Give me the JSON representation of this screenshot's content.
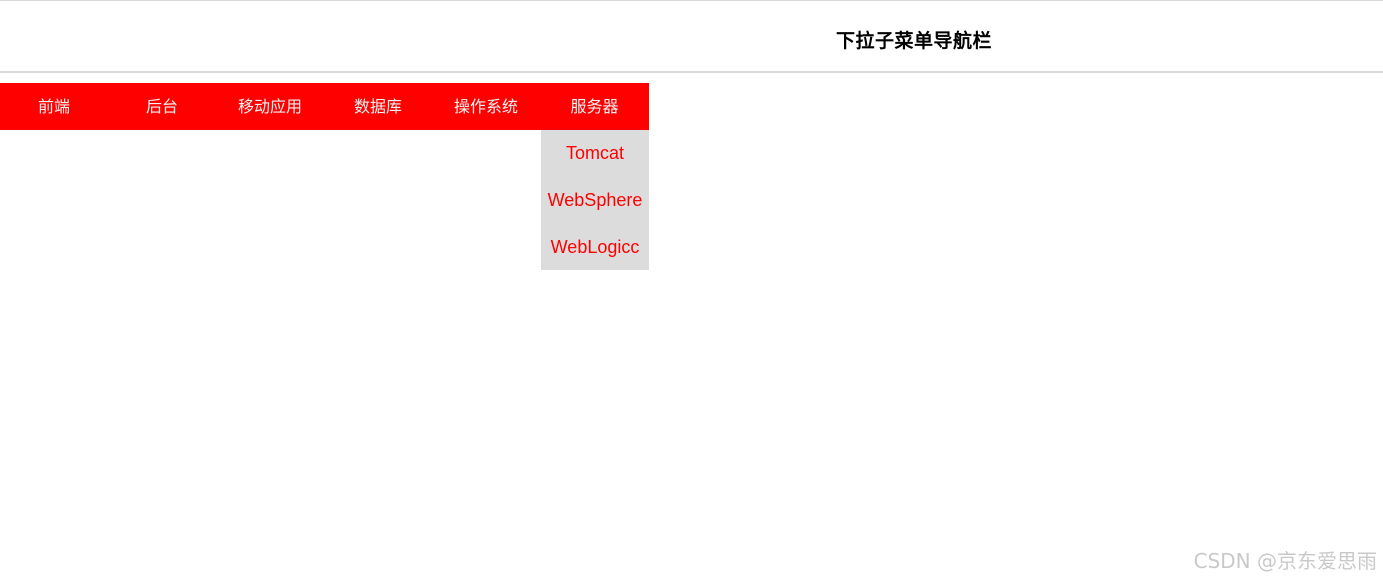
{
  "header": {
    "title": "下拉子菜单导航栏"
  },
  "nav": {
    "items": [
      {
        "label": "前端"
      },
      {
        "label": "后台"
      },
      {
        "label": "移动应用"
      },
      {
        "label": "数据库"
      },
      {
        "label": "操作系统"
      },
      {
        "label": "服务器"
      }
    ],
    "active_dropdown": {
      "parent": "服务器",
      "items": [
        {
          "label": "Tomcat"
        },
        {
          "label": "WebSphere"
        },
        {
          "label": "WebLogicc"
        }
      ]
    }
  },
  "watermark": {
    "text": "CSDN @京东爱思雨"
  },
  "colors": {
    "nav_background": "#ff0000",
    "nav_text": "#f2f2f2",
    "dropdown_background": "#dcdcdc",
    "dropdown_text": "#ff0000"
  }
}
